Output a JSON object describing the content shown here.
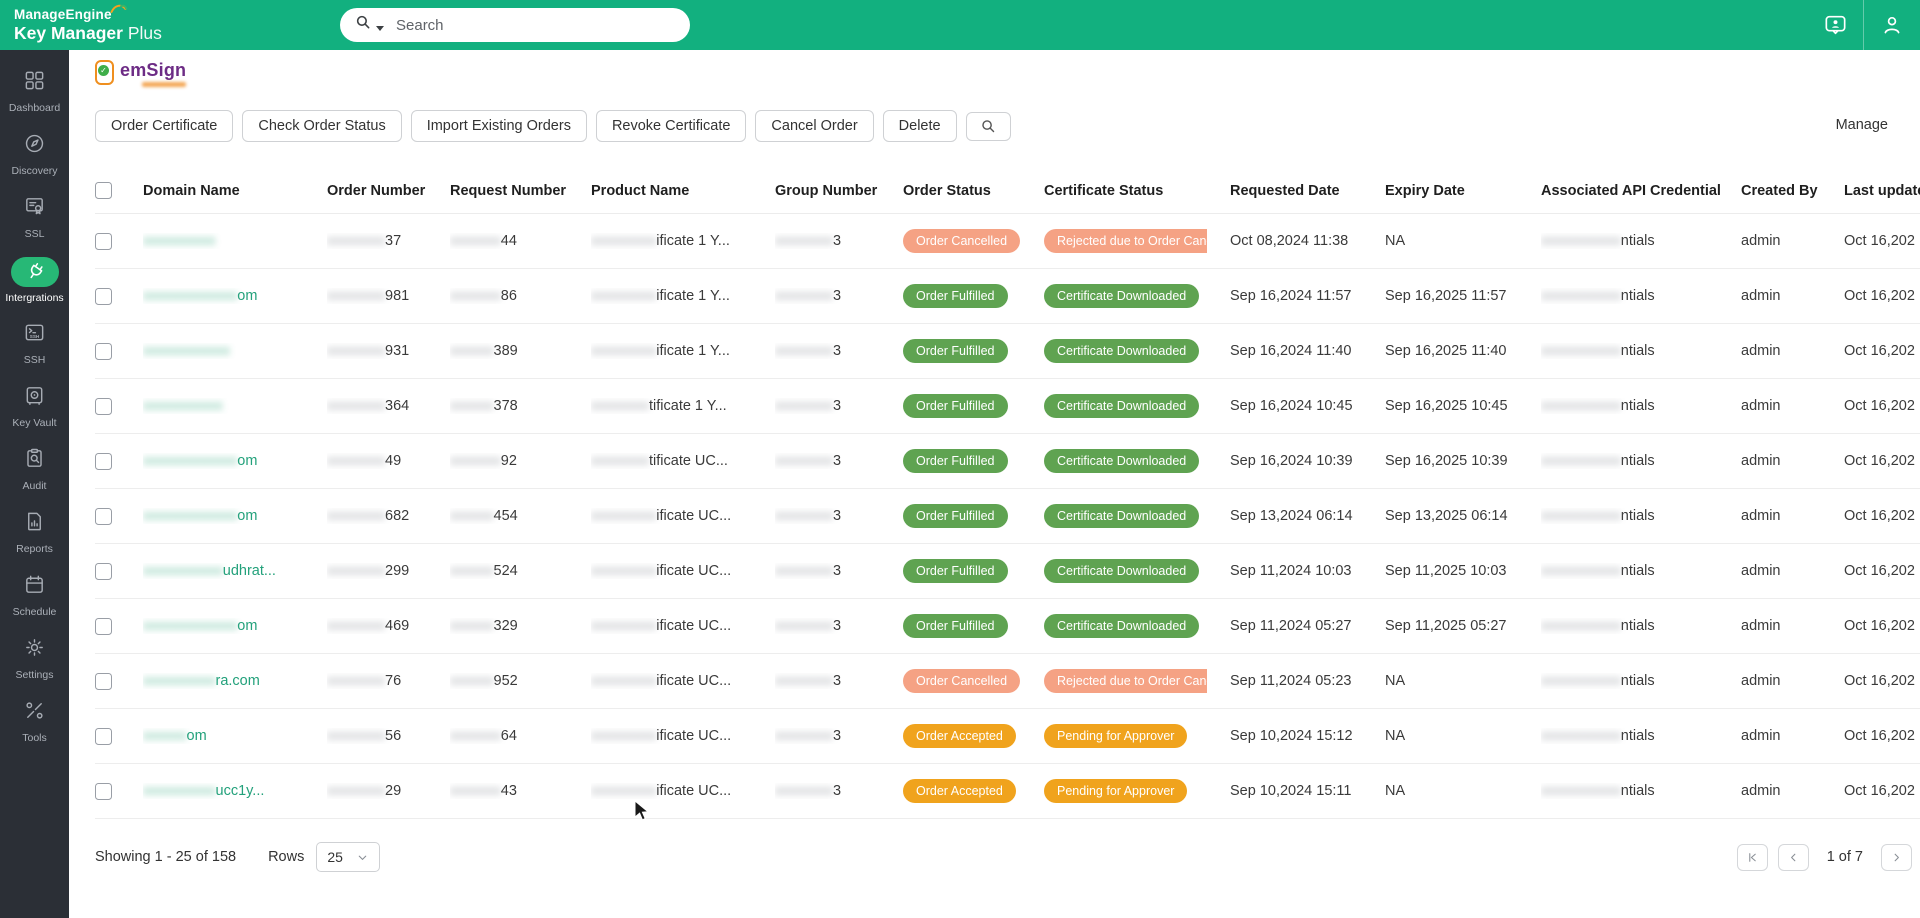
{
  "topbar": {
    "brand_line1": "ManageEngine",
    "brand_line2_bold": "Key Manager",
    "brand_line2_light": "Plus",
    "search_placeholder": "Search",
    "icons": [
      "feedback-icon",
      "user-icon"
    ]
  },
  "sidebar": {
    "items": [
      {
        "label": "Dashboard",
        "icon": "dashboard-icon",
        "active": false
      },
      {
        "label": "Discovery",
        "icon": "discovery-icon",
        "active": false
      },
      {
        "label": "SSL",
        "icon": "ssl-icon",
        "active": false
      },
      {
        "label": "Intergrations",
        "icon": "integrations-plug-icon",
        "active": true
      },
      {
        "label": "SSH",
        "icon": "ssh-icon",
        "active": false
      },
      {
        "label": "Key Vault",
        "icon": "key-vault-icon",
        "active": false
      },
      {
        "label": "Audit",
        "icon": "audit-icon",
        "active": false
      },
      {
        "label": "Reports",
        "icon": "reports-icon",
        "active": false
      },
      {
        "label": "Schedule",
        "icon": "schedule-icon",
        "active": false
      },
      {
        "label": "Settings",
        "icon": "settings-icon",
        "active": false
      },
      {
        "label": "Tools",
        "icon": "tools-icon",
        "active": false
      }
    ]
  },
  "integration": {
    "logo_text": "emSign"
  },
  "toolbar": {
    "buttons": [
      "Order Certificate",
      "Check Order Status",
      "Import Existing Orders",
      "Revoke Certificate",
      "Cancel Order",
      "Delete"
    ],
    "search_icon": "search-icon",
    "manage_label": "Manage"
  },
  "table": {
    "headers": [
      "Domain Name",
      "Order Number",
      "Request Number",
      "Product Name",
      "Group Number",
      "Order Status",
      "Certificate Status",
      "Requested Date",
      "Expiry Date",
      "Associated API Credential",
      "Created By",
      "Last updated"
    ],
    "status_colors": {
      "green": "#5FA351",
      "salmon": "#F5A284",
      "amber": "#F0A31D"
    },
    "rows": [
      {
        "d_blur": "xxxxxxxxxx",
        "d_clear": "",
        "o_blur": "xxxxxxxx",
        "o_clear": "37",
        "r_blur": "xxxxxxx",
        "r_clear": "44",
        "p_blur": "xxxxxxxxx",
        "p_clear": "ificate 1 Y...",
        "g_blur": "xxxxxxxx",
        "g_clear": "3",
        "status": "Order Cancelled",
        "status_type": "salmon",
        "cert": "Rejected due to Order Cancellation",
        "cert_type": "salmon",
        "cert_clip": true,
        "req": "Oct 08,2024 11:38",
        "exp": "NA",
        "a_blur": "xxxxxxxxxxx",
        "a_clear": "ntials",
        "created": "admin",
        "updated": "Oct 16,202"
      },
      {
        "d_blur": "xxxxxxxxxxxxx",
        "d_clear": "om",
        "o_blur": "xxxxxxxx",
        "o_clear": "981",
        "r_blur": "xxxxxxx",
        "r_clear": "86",
        "p_blur": "xxxxxxxxx",
        "p_clear": "ificate 1 Y...",
        "g_blur": "xxxxxxxx",
        "g_clear": "3",
        "status": "Order Fulfilled",
        "status_type": "green",
        "cert": "Certificate Downloaded",
        "cert_type": "green",
        "cert_clip": false,
        "req": "Sep 16,2024 11:57",
        "exp": "Sep 16,2025 11:57",
        "a_blur": "xxxxxxxxxxx",
        "a_clear": "ntials",
        "created": "admin",
        "updated": "Oct 16,202"
      },
      {
        "d_blur": "xxxxxxxxxxxx",
        "d_clear": "",
        "o_blur": "xxxxxxxx",
        "o_clear": "931",
        "r_blur": "xxxxxx",
        "r_clear": "389",
        "p_blur": "xxxxxxxxx",
        "p_clear": "ificate 1 Y...",
        "g_blur": "xxxxxxxx",
        "g_clear": "3",
        "status": "Order Fulfilled",
        "status_type": "green",
        "cert": "Certificate Downloaded",
        "cert_type": "green",
        "cert_clip": false,
        "req": "Sep 16,2024 11:40",
        "exp": "Sep 16,2025 11:40",
        "a_blur": "xxxxxxxxxxx",
        "a_clear": "ntials",
        "created": "admin",
        "updated": "Oct 16,202"
      },
      {
        "d_blur": "xxxxxxxxxxx",
        "d_clear": "",
        "o_blur": "xxxxxxxx",
        "o_clear": "364",
        "r_blur": "xxxxxx",
        "r_clear": "378",
        "p_blur": "xxxxxxxx",
        "p_clear": "tificate 1 Y...",
        "g_blur": "xxxxxxxx",
        "g_clear": "3",
        "status": "Order Fulfilled",
        "status_type": "green",
        "cert": "Certificate Downloaded",
        "cert_type": "green",
        "cert_clip": false,
        "req": "Sep 16,2024 10:45",
        "exp": "Sep 16,2025 10:45",
        "a_blur": "xxxxxxxxxxx",
        "a_clear": "ntials",
        "created": "admin",
        "updated": "Oct 16,202"
      },
      {
        "d_blur": "xxxxxxxxxxxxx",
        "d_clear": "om",
        "o_blur": "xxxxxxxx",
        "o_clear": "49",
        "r_blur": "xxxxxxx",
        "r_clear": "92",
        "p_blur": "xxxxxxxx",
        "p_clear": "tificate UC...",
        "g_blur": "xxxxxxxx",
        "g_clear": "3",
        "status": "Order Fulfilled",
        "status_type": "green",
        "cert": "Certificate Downloaded",
        "cert_type": "green",
        "cert_clip": false,
        "req": "Sep 16,2024 10:39",
        "exp": "Sep 16,2025 10:39",
        "a_blur": "xxxxxxxxxxx",
        "a_clear": "ntials",
        "created": "admin",
        "updated": "Oct 16,202"
      },
      {
        "d_blur": "xxxxxxxxxxxxx",
        "d_clear": "om",
        "o_blur": "xxxxxxxx",
        "o_clear": "682",
        "r_blur": "xxxxxx",
        "r_clear": "454",
        "p_blur": "xxxxxxxxx",
        "p_clear": "ificate UC...",
        "g_blur": "xxxxxxxx",
        "g_clear": "3",
        "status": "Order Fulfilled",
        "status_type": "green",
        "cert": "Certificate Downloaded",
        "cert_type": "green",
        "cert_clip": false,
        "req": "Sep 13,2024 06:14",
        "exp": "Sep 13,2025 06:14",
        "a_blur": "xxxxxxxxxxx",
        "a_clear": "ntials",
        "created": "admin",
        "updated": "Oct 16,202"
      },
      {
        "d_blur": "xxxxxxxxxxx",
        "d_clear": "udhrat...",
        "o_blur": "xxxxxxxx",
        "o_clear": "299",
        "r_blur": "xxxxxx",
        "r_clear": "524",
        "p_blur": "xxxxxxxxx",
        "p_clear": "ificate UC...",
        "g_blur": "xxxxxxxx",
        "g_clear": "3",
        "status": "Order Fulfilled",
        "status_type": "green",
        "cert": "Certificate Downloaded",
        "cert_type": "green",
        "cert_clip": false,
        "req": "Sep 11,2024 10:03",
        "exp": "Sep 11,2025 10:03",
        "a_blur": "xxxxxxxxxxx",
        "a_clear": "ntials",
        "created": "admin",
        "updated": "Oct 16,202"
      },
      {
        "d_blur": "xxxxxxxxxxxxx",
        "d_clear": "om",
        "o_blur": "xxxxxxxx",
        "o_clear": "469",
        "r_blur": "xxxxxx",
        "r_clear": "329",
        "p_blur": "xxxxxxxxx",
        "p_clear": "ificate UC...",
        "g_blur": "xxxxxxxx",
        "g_clear": "3",
        "status": "Order Fulfilled",
        "status_type": "green",
        "cert": "Certificate Downloaded",
        "cert_type": "green",
        "cert_clip": false,
        "req": "Sep 11,2024 05:27",
        "exp": "Sep 11,2025 05:27",
        "a_blur": "xxxxxxxxxxx",
        "a_clear": "ntials",
        "created": "admin",
        "updated": "Oct 16,202"
      },
      {
        "d_blur": "xxxxxxxxxx",
        "d_clear": "ra.com",
        "o_blur": "xxxxxxxx",
        "o_clear": "76",
        "r_blur": "xxxxxx",
        "r_clear": "952",
        "p_blur": "xxxxxxxxx",
        "p_clear": "ificate UC...",
        "g_blur": "xxxxxxxx",
        "g_clear": "3",
        "status": "Order Cancelled",
        "status_type": "salmon",
        "cert": "Rejected due to Order Cancellation",
        "cert_type": "salmon",
        "cert_clip": true,
        "req": "Sep 11,2024 05:23",
        "exp": "NA",
        "a_blur": "xxxxxxxxxxx",
        "a_clear": "ntials",
        "created": "admin",
        "updated": "Oct 16,202"
      },
      {
        "d_blur": "xxxxxx",
        "d_clear": "om",
        "o_blur": "xxxxxxxx",
        "o_clear": "56",
        "r_blur": "xxxxxxx",
        "r_clear": "64",
        "p_blur": "xxxxxxxxx",
        "p_clear": "ificate UC...",
        "g_blur": "xxxxxxxx",
        "g_clear": "3",
        "status": "Order Accepted",
        "status_type": "amber",
        "cert": "Pending for Approver",
        "cert_type": "amber",
        "cert_clip": false,
        "req": "Sep 10,2024 15:12",
        "exp": "NA",
        "a_blur": "xxxxxxxxxxx",
        "a_clear": "ntials",
        "created": "admin",
        "updated": "Oct 16,202"
      },
      {
        "d_blur": "xxxxxxxxxx",
        "d_clear": "ucc1y...",
        "o_blur": "xxxxxxxx",
        "o_clear": "29",
        "r_blur": "xxxxxxx",
        "r_clear": "43",
        "p_blur": "xxxxxxxxx",
        "p_clear": "ificate UC...",
        "g_blur": "xxxxxxxx",
        "g_clear": "3",
        "status": "Order Accepted",
        "status_type": "amber",
        "cert": "Pending for Approver",
        "cert_type": "amber",
        "cert_clip": false,
        "req": "Sep 10,2024 15:11",
        "exp": "NA",
        "a_blur": "xxxxxxxxxxx",
        "a_clear": "ntials",
        "created": "admin",
        "updated": "Oct 16,202"
      }
    ]
  },
  "footer": {
    "showing": "Showing 1 - 25 of 158",
    "rows_label": "Rows",
    "rows_value": "25",
    "page_label": "1 of 7",
    "pager_icons": [
      "first-page-icon",
      "prev-page-icon",
      "next-page-icon",
      "last-page-icon"
    ]
  },
  "colors": {
    "topbar_green": "#12B07F",
    "sidebar_dark": "#2B2F36",
    "active_pill_green": "#27B876",
    "domain_link_green": "#23A17B"
  }
}
